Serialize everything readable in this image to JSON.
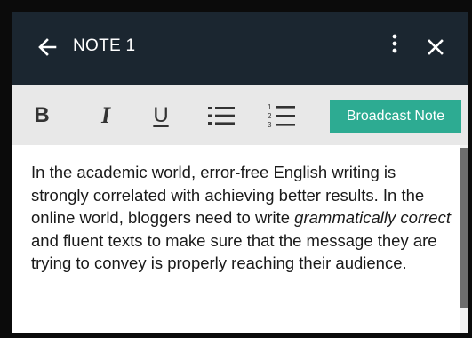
{
  "header": {
    "title": "NOTE 1",
    "back_icon": "arrow-left-icon",
    "menu_icon": "more-vertical-icon",
    "close_icon": "close-icon",
    "background_color": "#1b2630"
  },
  "toolbar": {
    "bold_label": "B",
    "italic_label": "I",
    "underline_label": "U",
    "bullet_list_icon": "bullet-list-icon",
    "numbered_list_icon": "numbered-list-icon",
    "broadcast_label": "Broadcast Note",
    "broadcast_color": "#2dab92"
  },
  "note": {
    "text_before": "In the academic world, error-free English writing is strongly correlated with achieving better results. In the online world, bloggers need to write ",
    "text_italic": "grammatically correct",
    "text_after": " and fluent texts to make sure that the message they are trying to convey is properly reaching their audience."
  }
}
